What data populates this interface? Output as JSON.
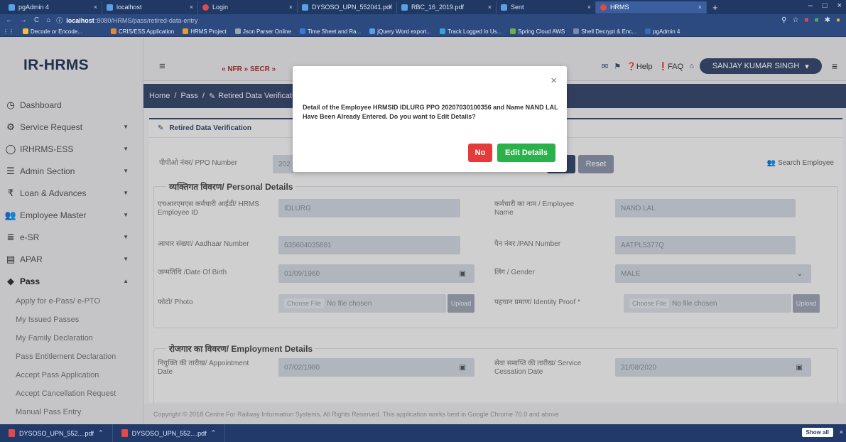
{
  "browser": {
    "tabs": [
      {
        "label": "pgAdmin 4"
      },
      {
        "label": "localhost"
      },
      {
        "label": "Login"
      },
      {
        "label": "DYSOSO_UPN_552041.pdf"
      },
      {
        "label": "RBC_16_2019.pdf"
      },
      {
        "label": "Sent"
      },
      {
        "label": "HRMS",
        "active": true
      }
    ],
    "url_host": "localhost",
    "url_path": ":8080/HRMS/pass/retired-data-entry",
    "bookmarks": [
      "Decode or Encode...",
      "CRIS/ESS Application",
      "HRMS Project",
      "Json Parser Online",
      "Time Sheet and Ra...",
      "jQuery Word export...",
      "Track Logged In Us...",
      "Spring Cloud AWS",
      "Shell Decrypt & Enc...",
      "pgAdmin 4"
    ]
  },
  "app": {
    "brand": "IR-HRMS",
    "nfr_text": "« NFR » SECR »",
    "help_label": "Help",
    "faq_label": "FAQ",
    "user_name": "SANJAY KUMAR SINGH"
  },
  "sidebar": {
    "items": [
      {
        "label": "Dashboard",
        "icon": "clock-icon"
      },
      {
        "label": "Service Request",
        "icon": "cogs-icon"
      },
      {
        "label": "IRHRMS-ESS",
        "icon": "user-icon"
      },
      {
        "label": "Admin Section",
        "icon": "list-icon"
      },
      {
        "label": "Loan & Advances",
        "icon": "rupee-icon"
      },
      {
        "label": "Employee Master",
        "icon": "users-icon"
      },
      {
        "label": "e-SR",
        "icon": "database-icon"
      },
      {
        "label": "APAR",
        "icon": "id-card-icon"
      },
      {
        "label": "Pass",
        "icon": "ticket-icon"
      }
    ],
    "pass_sub_items": [
      "Apply for e-Pass/ e-PTO",
      "My Issued Passes",
      "My Family Declaration",
      "Pass Entitlement Declaration",
      "Accept Pass Application",
      "Accept Cancellation Request",
      "Manual Pass Entry"
    ]
  },
  "breadcrumb": {
    "home": "Home",
    "sep": "/",
    "pass": "Pass",
    "current": "Retired Data Verification"
  },
  "card": {
    "title": "Retired Data Verification",
    "ppo_label": "पीपीओ नंबर/ PPO Number",
    "ppo_value": "202",
    "reset_label": "Reset",
    "search_employee": "Search Employee"
  },
  "personal": {
    "section_title": "व्यक्तिगत विवरण/ Personal Details",
    "hrms_label": "एचआरएमएस कर्मचारी आईडी/ HRMS Employee ID",
    "hrms_value": "IDLURG",
    "name_label": "कर्मचारी का नाम / Employee Name",
    "name_value": "NAND LAL",
    "aadhaar_label": "आधार संख्या/ Aadhaar Number",
    "aadhaar_value": "635604035881",
    "pan_label": "पैन नंबर /PAN Number",
    "pan_value": "AATPL5377Q",
    "dob_label": "जन्मतिथि /Date Of Birth",
    "dob_value": "01/09/1960",
    "gender_label": "लिंग / Gender",
    "gender_value": "MALE",
    "photo_label": "फोटो/ Photo",
    "identity_label": "पहचान प्रमाण/ Identity Proof *",
    "choose_file": "Choose File",
    "no_file": "No file chosen",
    "upload": "Upload"
  },
  "employment": {
    "section_title": "रोजगार का विवरण/ Employment Details",
    "appointment_label": "नियुक्ति की तारीख/ Appointment Date",
    "appointment_value": "07/02/1980",
    "cessation_label": "सेवा समाप्ति की तारीख/ Service Cessation Date",
    "cessation_value": "31/08/2020"
  },
  "footer": "Copyright © 2018 Centre For Railway Information Systems. All Rights Reserved. This application works best in Google Chrome 70.0 and above",
  "downloads": {
    "items": [
      "DYSOSO_UPN_552....pdf",
      "DYSOSO_UPN_552....pdf"
    ],
    "show_all": "Show all"
  },
  "modal": {
    "message": "Detail of the Employee HRMSID IDLURG PPO 20207030100356 and Name NAND LAL Have Been Already Entered. Do you want to Edit Details?",
    "no_label": "No",
    "edit_label": "Edit Details",
    "close": "×"
  }
}
